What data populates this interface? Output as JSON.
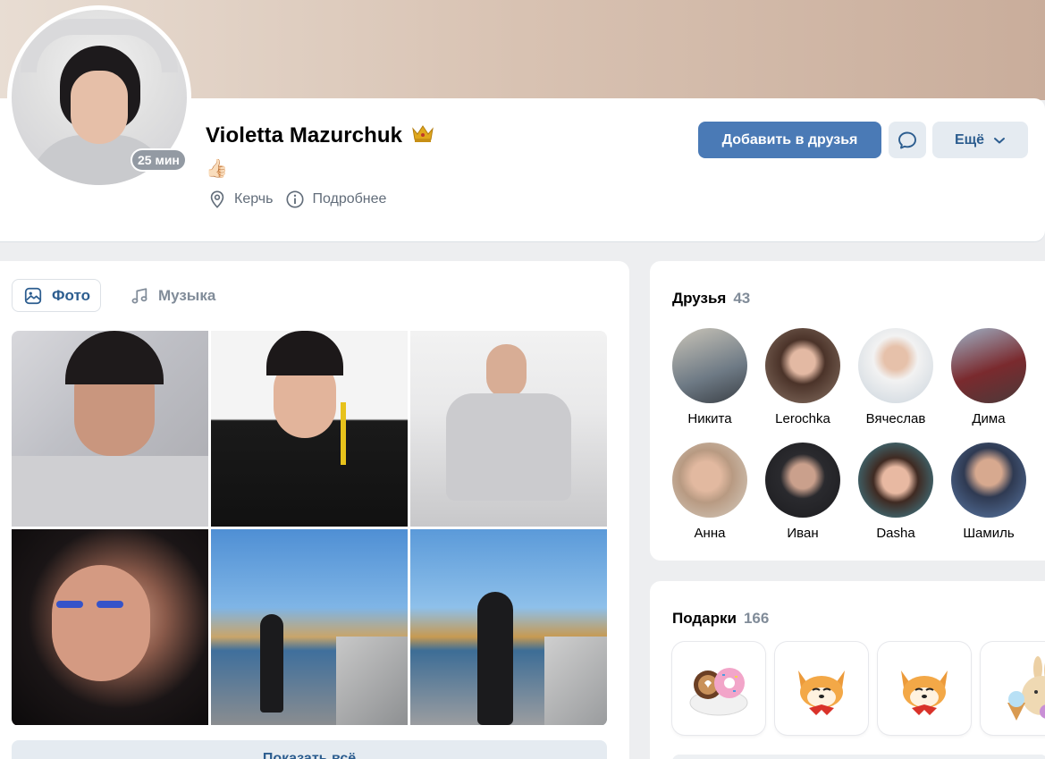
{
  "profile": {
    "name": "Violetta Mazurchuk",
    "crown_icon": "crown-icon",
    "status_emoji": "👍🏻",
    "online_badge": "25 мин",
    "city": "Керчь",
    "details_label": "Подробнее"
  },
  "actions": {
    "add_friend": "Добавить в друзья",
    "more": "Ещё"
  },
  "media": {
    "tabs": [
      {
        "label": "Фото",
        "icon": "image-icon",
        "active": true
      },
      {
        "label": "Музыка",
        "icon": "music-note-icon",
        "active": false
      }
    ],
    "show_all": "Показать всё"
  },
  "friends": {
    "title": "Друзья",
    "count": "43",
    "items": [
      {
        "name": "Никита",
        "color": "#6e7a85"
      },
      {
        "name": "Lerochka",
        "color": "#8a7466"
      },
      {
        "name": "Вячеслав",
        "color": "#c9d3dc"
      },
      {
        "name": "Дима",
        "color": "#7a2a2e"
      },
      {
        "name": "Анна",
        "color": "#b89a82"
      },
      {
        "name": "Иван",
        "color": "#2a2a2e"
      },
      {
        "name": "Dasha",
        "color": "#3f8fa3"
      },
      {
        "name": "Шамиль",
        "color": "#5b7aa8"
      }
    ]
  },
  "gifts": {
    "title": "Подарки",
    "count": "166"
  },
  "colors": {
    "accent": "#4a7ab6",
    "link": "#2c5d8f",
    "secondary_text": "#818c99",
    "page_bg": "#edeef0"
  }
}
